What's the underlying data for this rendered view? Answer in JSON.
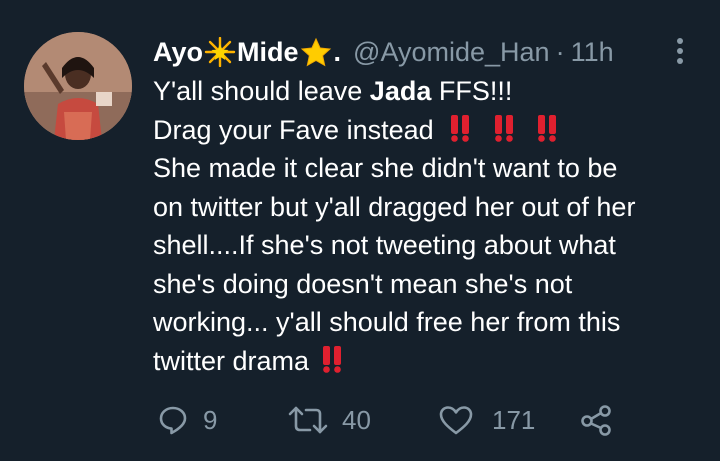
{
  "tweet": {
    "author_name_parts": [
      "Ayo",
      "Mide"
    ],
    "author_name_emoji": [
      "glowing-star",
      "star"
    ],
    "author_name_trailing": ".",
    "handle": "@Ayomide_Han",
    "separator": "·",
    "timestamp": "11h",
    "body_lines": [
      {
        "segments": [
          {
            "text": "Y'all should leave ",
            "bold": false
          },
          {
            "text": "Jada",
            "bold": true
          },
          {
            "text": " FFS!!!",
            "bold": false
          }
        ]
      },
      {
        "segments": [
          {
            "text": "Drag your Fave instead",
            "bold": false
          }
        ],
        "emoji_after": 3
      },
      {
        "segments": [
          {
            "text": "She made it clear she didn't want to be",
            "bold": false
          }
        ]
      },
      {
        "segments": [
          {
            "text": "on twitter but y'all dragged her out of her",
            "bold": false
          }
        ]
      },
      {
        "segments": [
          {
            "text": "shell....If she's not tweeting about what",
            "bold": false
          }
        ]
      },
      {
        "segments": [
          {
            "text": "she's doing doesn't mean she's not",
            "bold": false
          }
        ]
      },
      {
        "segments": [
          {
            "text": "working... y'all should free her from this",
            "bold": false
          }
        ]
      },
      {
        "segments": [
          {
            "text": "twitter drama",
            "bold": false
          }
        ],
        "emoji_after": 1
      }
    ],
    "emoji_name": "double-exclamation",
    "actions": {
      "reply": {
        "icon": "reply-icon",
        "count": "9"
      },
      "retweet": {
        "icon": "retweet-icon",
        "count": "40"
      },
      "like": {
        "icon": "heart-icon",
        "count": "171"
      },
      "share": {
        "icon": "share-icon"
      }
    }
  },
  "colors": {
    "background": "#15202b",
    "text": "#ffffff",
    "secondary": "#8899a6",
    "emoji_red": "#e0202f",
    "star_yellow": "#ffcc00"
  }
}
